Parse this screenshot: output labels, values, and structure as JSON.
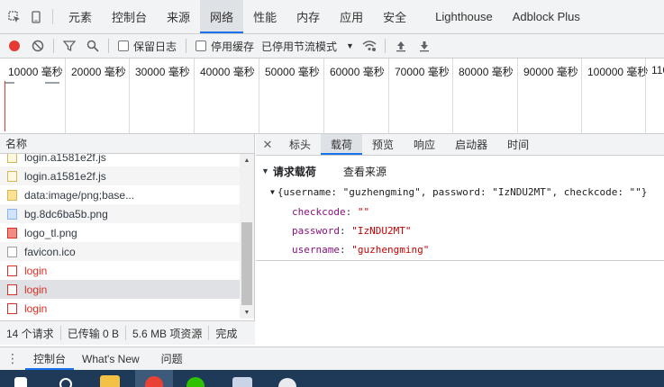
{
  "topbar": {
    "tabs": [
      {
        "label": "元素",
        "active": false
      },
      {
        "label": "控制台",
        "active": false
      },
      {
        "label": "来源",
        "active": false
      },
      {
        "label": "网络",
        "active": true
      },
      {
        "label": "性能",
        "active": false
      },
      {
        "label": "内存",
        "active": false
      },
      {
        "label": "应用",
        "active": false
      },
      {
        "label": "安全",
        "active": false
      },
      {
        "label": "Lighthouse",
        "active": false
      },
      {
        "label": "Adblock Plus",
        "active": false
      }
    ]
  },
  "toolbar": {
    "preserve_log": "保留日志",
    "disable_cache": "停用缓存",
    "throttling": "已停用节流模式"
  },
  "overview": {
    "ticks": [
      "10000 毫秒",
      "20000 毫秒",
      "30000 毫秒",
      "40000 毫秒",
      "50000 毫秒",
      "60000 毫秒",
      "70000 毫秒",
      "80000 毫秒",
      "90000 毫秒",
      "100000 毫秒",
      "110"
    ]
  },
  "list": {
    "header": "名称",
    "rows": [
      {
        "name": "login.a1581e2f.js",
        "icon": "js"
      },
      {
        "name": "login.a1581e2f.js",
        "icon": "js"
      },
      {
        "name": "data:image/png;base...",
        "icon": "img"
      },
      {
        "name": "bg.8dc6ba5b.png",
        "icon": "png"
      },
      {
        "name": "logo_tl.png",
        "icon": "logo"
      },
      {
        "name": "favicon.ico",
        "icon": "doc"
      },
      {
        "name": "login",
        "icon": "err"
      },
      {
        "name": "login",
        "icon": "err"
      },
      {
        "name": "login",
        "icon": "err"
      }
    ],
    "status": {
      "requests": "14 个请求",
      "transferred": "已传输 0 B",
      "resources": "5.6 MB 项资源",
      "finished": "完成"
    }
  },
  "detail": {
    "tabs": [
      "标头",
      "载荷",
      "预览",
      "响应",
      "启动器",
      "时间"
    ],
    "active_tab": "载荷",
    "section_title": "请求载荷",
    "view_source": "查看来源",
    "object_summary": "{username: \"guzhengming\", password: \"IzNDU2MT\", checkcode: \"\"}",
    "fields": [
      {
        "key": "checkcode",
        "value": "\"\""
      },
      {
        "key": "password",
        "value": "\"IzNDU2MT\""
      },
      {
        "key": "username",
        "value": "\"guzhengming\""
      }
    ]
  },
  "drawer": {
    "tabs": [
      "控制台",
      "What's New",
      "问题"
    ]
  },
  "colors": {
    "accent": "#1a73e8",
    "record": "#e53935",
    "error": "#d93025"
  }
}
